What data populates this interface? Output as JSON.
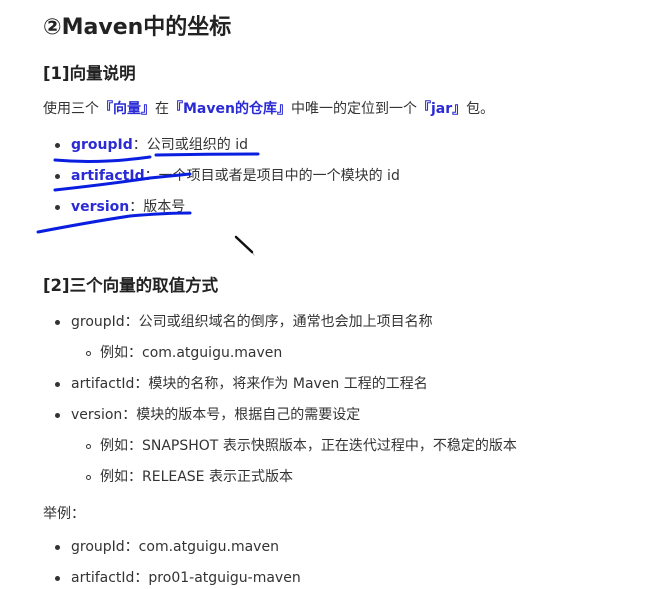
{
  "title": "②Maven中的坐标",
  "section1": {
    "heading": "[1]向量说明",
    "intro": {
      "pre": "使用三个",
      "q1": "『向量』",
      "mid1": "在",
      "q2": "『Maven的仓库』",
      "mid2": "中唯一的定位到一个",
      "q3": "『jar』",
      "post": "包。"
    },
    "items": [
      {
        "key": "groupId",
        "desc": "：公司或组织的 id"
      },
      {
        "key": "artifactId",
        "desc": "：一个项目或者是项目中的一个模块的 id"
      },
      {
        "key": "version",
        "desc": "：版本号"
      }
    ]
  },
  "section2": {
    "heading": "[2]三个向量的取值方式",
    "items": [
      {
        "text": "groupId：公司或组织域名的倒序，通常也会加上项目名称",
        "sub": [
          "例如：com.atguigu.maven"
        ]
      },
      {
        "text": "artifactId：模块的名称，将来作为 Maven 工程的工程名",
        "sub": []
      },
      {
        "text": "version：模块的版本号，根据自己的需要设定",
        "sub": [
          "例如：SNAPSHOT 表示快照版本，正在迭代过程中，不稳定的版本",
          "例如：RELEASE 表示正式版本"
        ]
      }
    ]
  },
  "example": {
    "label": "举例：",
    "items": [
      "groupId：com.atguigu.maven",
      "artifactId：pro01-atguigu-maven"
    ]
  },
  "colors": {
    "highlight": "#2b2bd6",
    "annotation_ink": "#0a1ee0"
  }
}
